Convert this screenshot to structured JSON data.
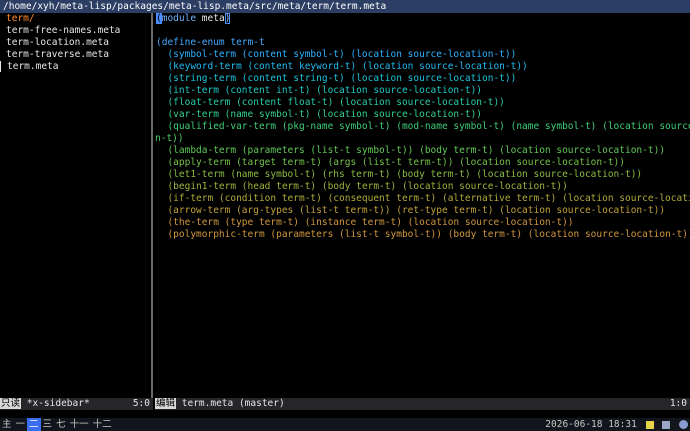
{
  "path_bar": "/home/xyh/meta-lisp/packages/meta-lisp.meta/src/meta/term/term.meta",
  "sidebar": {
    "items": [
      {
        "label": "term/",
        "kind": "dir"
      },
      {
        "label": "term-free-names.meta",
        "kind": "file"
      },
      {
        "label": "term-location.meta",
        "kind": "file"
      },
      {
        "label": "term-traverse.meta",
        "kind": "file"
      },
      {
        "label": "term.meta",
        "kind": "current"
      }
    ]
  },
  "editor": {
    "line1_paren": "(",
    "line1_keyword": "module",
    "line1_name": "meta",
    "line1_close": ")",
    "lines": [
      "",
      "(define-enum term-t",
      "  (symbol-term (content symbol-t) (location source-location-t))",
      "  (keyword-term (content keyword-t) (location source-location-t))",
      "  (string-term (content string-t) (location source-location-t))",
      "  (int-term (content int-t) (location source-location-t))",
      "  (float-term (content float-t) (location source-location-t))",
      "  (var-term (name symbol-t) (location source-location-t))",
      "  (qualified-var-term (pkg-name symbol-t) (mod-name symbol-t) (name symbol-t) (location source-locatio-",
      "n-t))",
      "  (lambda-term (parameters (list-t symbol-t)) (body term-t) (location source-location-t))",
      "  (apply-term (target term-t) (args (list-t term-t)) (location source-location-t))",
      "  (let1-term (name symbol-t) (rhs term-t) (body term-t) (location source-location-t))",
      "  (begin1-term (head term-t) (body term-t) (location source-location-t))",
      "  (if-term (condition term-t) (consequent term-t) (alternative term-t) (location source-location-t))",
      "  (arrow-term (arg-types (list-t term-t)) (ret-type term-t) (location source-location-t))",
      "  (the-term (type term-t) (instance term-t) (location source-location-t))",
      "  (polymorphic-term (parameters (list-t symbol-t)) (body term-t) (location source-location-t)))"
    ]
  },
  "modeline_left": {
    "read_only": "只读",
    "buffer": "*x-sidebar*",
    "position": "5:0"
  },
  "modeline_right": {
    "mode": "编辑",
    "buffer": "term.meta (master)",
    "position": "1:0"
  },
  "taskbar": {
    "workspaces": [
      "主",
      "一",
      "二",
      "三",
      "七",
      "十一",
      "十二"
    ],
    "active_workspace": "二",
    "datetime": "2026-06-18 18:31"
  },
  "colors": {
    "accent": "#3a6df0",
    "dir": "#ff8a2a",
    "path_bar": "#2c3e63"
  }
}
